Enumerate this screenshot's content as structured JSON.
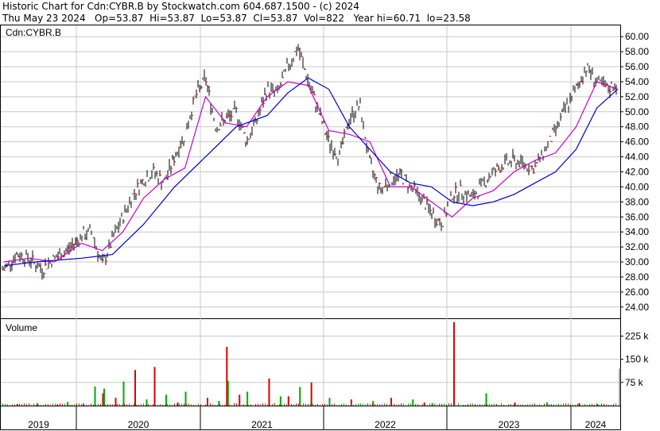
{
  "header": {
    "line1": "Historic Chart for Cdn:CYBR.B by Stockwatch.com 604.687.1500 - (c) 2024",
    "line2": "Thu May 23 2024   Op=53.87  Hi=53.87  Lo=53.87  Cl=53.87  Vol=822   Year hi=60.71  lo=23.58"
  },
  "price_panel": {
    "symbol_label": "Cdn:CYBR.B"
  },
  "volume_panel": {
    "label": "Volume"
  },
  "colors": {
    "background": "#ffffff",
    "grid": "#c8c8c8",
    "price_bar": "#000000",
    "close_marker": "#ff0000",
    "ma_short": "#cc00cc",
    "ma_long": "#0000cc",
    "volume_up": "#00aa00",
    "volume_down": "#dd0000",
    "volume_latest": "#999999"
  },
  "chart_data": [
    {
      "type": "line",
      "title": "Cdn:CYBR.B",
      "y_axis": {
        "ticks": [
          "24.00",
          "26.00",
          "28.00",
          "30.00",
          "32.00",
          "34.00",
          "36.00",
          "38.00",
          "40.00",
          "42.00",
          "44.00",
          "46.00",
          "48.00",
          "50.00",
          "52.00",
          "54.00",
          "56.00",
          "58.00",
          "60.00"
        ],
        "ylim": [
          22.5,
          61.5
        ]
      },
      "x_axis": {
        "labels": [
          "2019",
          "2020",
          "2021",
          "2022",
          "2023",
          "2024"
        ]
      },
      "legend": "none",
      "grid": true,
      "series": [
        {
          "name": "",
          "x": [
            "2019-01",
            "2019-03",
            "2019-05",
            "2019-07",
            "2019-09",
            "2019-11",
            "2020-01",
            "2020-02",
            "2020-03",
            "2020-04",
            "2020-05",
            "2020-06",
            "2020-07",
            "2020-08",
            "2020-09",
            "2020-10",
            "2020-11",
            "2020-12",
            "2021-01",
            "2021-02",
            "2021-03",
            "2021-04",
            "2021-05",
            "2021-06",
            "2021-07",
            "2021-08",
            "2021-09",
            "2021-10",
            "2021-11",
            "2021-12",
            "2022-01",
            "2022-02",
            "2022-03",
            "2022-04",
            "2022-05",
            "2022-06",
            "2022-07",
            "2022-08",
            "2022-09",
            "2022-10",
            "2022-11",
            "2022-12",
            "2023-01",
            "2023-02",
            "2023-03",
            "2023-04",
            "2023-05",
            "2023-06",
            "2023-07",
            "2023-08",
            "2023-09",
            "2023-10",
            "2023-11",
            "2023-12",
            "2024-01",
            "2024-02",
            "2024-03",
            "2024-04",
            "2024-05"
          ],
          "values": [
            29.0,
            31.0,
            30.5,
            29.0,
            30.5,
            31.5,
            33.5,
            34.0,
            29.5,
            33.0,
            36.0,
            39.0,
            41.0,
            42.0,
            40.5,
            44.0,
            47.0,
            52.0,
            54.5,
            48.0,
            49.0,
            50.0,
            46.0,
            49.0,
            53.0,
            52.5,
            56.0,
            58.5,
            54.0,
            50.0,
            46.0,
            44.0,
            49.0,
            51.0,
            43.0,
            39.5,
            41.0,
            41.5,
            40.0,
            38.5,
            36.5,
            35.0,
            39.0,
            39.5,
            38.5,
            40.5,
            42.0,
            43.0,
            43.5,
            43.0,
            42.5,
            45.0,
            47.5,
            50.5,
            53.0,
            56.0,
            54.0,
            53.0,
            53.87
          ]
        },
        {
          "name": "",
          "x": [
            "2019-01",
            "2019-05",
            "2019-09",
            "2020-01",
            "2020-03",
            "2020-05",
            "2020-07",
            "2020-09",
            "2020-11",
            "2021-01",
            "2021-03",
            "2021-05",
            "2021-07",
            "2021-09",
            "2021-11",
            "2022-01",
            "2022-03",
            "2022-05",
            "2022-07",
            "2022-09",
            "2022-11",
            "2023-01",
            "2023-03",
            "2023-05",
            "2023-07",
            "2023-09",
            "2023-11",
            "2024-01",
            "2024-03",
            "2024-05"
          ],
          "values": [
            30.0,
            30.5,
            30.0,
            32.5,
            31.5,
            34.0,
            38.5,
            41.0,
            42.5,
            52.0,
            48.5,
            48.0,
            52.0,
            54.0,
            53.5,
            47.5,
            47.0,
            46.0,
            40.0,
            40.0,
            38.0,
            36.0,
            38.5,
            39.5,
            42.0,
            43.5,
            44.5,
            48.0,
            54.0,
            53.0
          ]
        },
        {
          "name": "",
          "x": [
            "2019-01",
            "2019-06",
            "2020-01",
            "2020-04",
            "2020-07",
            "2020-10",
            "2021-01",
            "2021-04",
            "2021-07",
            "2021-09",
            "2021-11",
            "2022-01",
            "2022-03",
            "2022-05",
            "2022-07",
            "2022-09",
            "2022-11",
            "2023-01",
            "2023-03",
            "2023-05",
            "2023-07",
            "2023-09",
            "2023-11",
            "2024-01",
            "2024-03",
            "2024-05"
          ],
          "values": [
            29.5,
            30.0,
            30.5,
            31.0,
            35.0,
            40.0,
            44.0,
            48.0,
            49.5,
            52.5,
            54.5,
            53.0,
            48.0,
            45.0,
            42.0,
            40.5,
            40.0,
            38.0,
            37.5,
            38.0,
            39.0,
            40.5,
            42.0,
            45.0,
            50.5,
            53.0
          ]
        }
      ]
    },
    {
      "type": "bar",
      "title": "Volume",
      "y_axis": {
        "ticks": [
          "75 k",
          "150 k",
          "225 k"
        ],
        "ylim": [
          0,
          280000
        ]
      },
      "x_axis": {
        "labels": [
          "2019",
          "2020",
          "2021",
          "2022",
          "2023",
          "2024"
        ]
      },
      "grid": true,
      "series": [
        {
          "name": "",
          "x": [
            "2019-03",
            "2019-06",
            "2019-09",
            "2019-11",
            "2020-01",
            "2020-02",
            "2020-03",
            "2020-03",
            "2020-04",
            "2020-05",
            "2020-06",
            "2020-07",
            "2020-08",
            "2020-09",
            "2020-10",
            "2020-11",
            "2021-01",
            "2021-02",
            "2021-03",
            "2021-03",
            "2021-04",
            "2021-05",
            "2021-07",
            "2021-08",
            "2021-09",
            "2021-10",
            "2021-11",
            "2022-01",
            "2022-03",
            "2022-05",
            "2022-07",
            "2022-09",
            "2022-10",
            "2022-11",
            "2023-01",
            "2023-04",
            "2023-07",
            "2023-10",
            "2024-01",
            "2024-03",
            "2024-05"
          ],
          "values": [
            5000,
            8000,
            4000,
            12000,
            6000,
            62000,
            40000,
            55000,
            25000,
            78000,
            115000,
            20000,
            125000,
            35000,
            10000,
            45000,
            25000,
            15000,
            190000,
            80000,
            35000,
            45000,
            88000,
            30000,
            30000,
            60000,
            75000,
            25000,
            20000,
            15000,
            25000,
            20000,
            10000,
            8000,
            270000,
            40000,
            10000,
            10000,
            8000,
            5000,
            120000
          ]
        }
      ]
    }
  ]
}
